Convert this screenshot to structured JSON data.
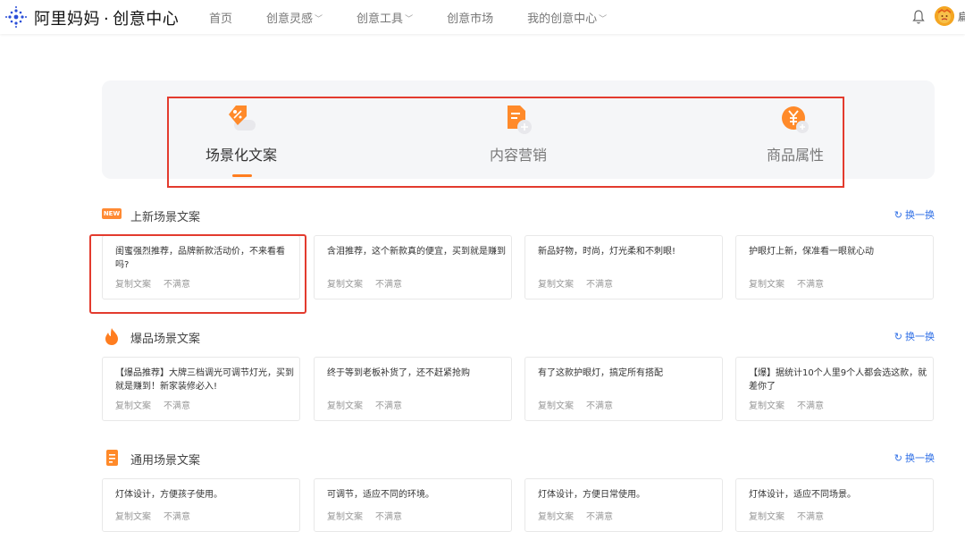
{
  "header": {
    "brand_main": "阿里妈妈",
    "brand_sep": "·",
    "brand_sub": "创意中心",
    "nav": [
      {
        "label": "首页",
        "has_dropdown": false
      },
      {
        "label": "创意灵感",
        "has_dropdown": true
      },
      {
        "label": "创意工具",
        "has_dropdown": true
      },
      {
        "label": "创意市场",
        "has_dropdown": false
      },
      {
        "label": "我的创意中心",
        "has_dropdown": true
      }
    ],
    "icons": {
      "bell": "bell-icon",
      "avatar": "avatar"
    },
    "avatar_text": "扁"
  },
  "tabs": {
    "active_index": 0,
    "items": [
      {
        "label": "场景化文案",
        "icon": "percent-tag-icon"
      },
      {
        "label": "内容营销",
        "icon": "document-edit-icon"
      },
      {
        "label": "商品属性",
        "icon": "yuan-coin-icon"
      }
    ]
  },
  "sections": [
    {
      "title": "上新场景文案",
      "icon": "new-badge-icon",
      "badge_text": "NEW",
      "refresh_label": "换一换",
      "cards": [
        {
          "text": "闺蜜强烈推荐，品牌新款活动价，不来看看吗?",
          "copy": "复制文案",
          "dislike": "不满意"
        },
        {
          "text": "含泪推荐，这个新款真的便宜，买到就是赚到",
          "copy": "复制文案",
          "dislike": "不满意"
        },
        {
          "text": "新品好物，时尚，灯光柔和不刺眼!",
          "copy": "复制文案",
          "dislike": "不满意"
        },
        {
          "text": "护眼灯上新，保准看一眼就心动",
          "copy": "复制文案",
          "dislike": "不满意"
        }
      ]
    },
    {
      "title": "爆品场景文案",
      "icon": "flame-icon",
      "refresh_label": "换一换",
      "cards": [
        {
          "text": "【爆品推荐】大牌三档调光可调节灯光，买到就是赚到！新家装修必入!",
          "copy": "复制文案",
          "dislike": "不满意"
        },
        {
          "text": "终于等到老板补货了，还不赶紧抢购",
          "copy": "复制文案",
          "dislike": "不满意"
        },
        {
          "text": "有了这款护眼灯，搞定所有搭配",
          "copy": "复制文案",
          "dislike": "不满意"
        },
        {
          "text": "【爆】据统计10个人里9个人都会选这款，就差你了",
          "copy": "复制文案",
          "dislike": "不满意"
        }
      ]
    },
    {
      "title": "通用场景文案",
      "icon": "document-icon",
      "refresh_label": "换一换",
      "cards": [
        {
          "text": "灯体设计，方便孩子使用。",
          "copy": "复制文案",
          "dislike": "不满意"
        },
        {
          "text": "可调节，适应不同的环境。",
          "copy": "复制文案",
          "dislike": "不满意"
        },
        {
          "text": "灯体设计，方便日常使用。",
          "copy": "复制文案",
          "dislike": "不满意"
        },
        {
          "text": "灯体设计，适应不同场景。",
          "copy": "复制文案",
          "dislike": "不满意"
        }
      ]
    }
  ],
  "colors": {
    "accent_orange": "#ff7d1f",
    "link_blue": "#2f6fe6",
    "highlight_red": "#e33b2e"
  }
}
